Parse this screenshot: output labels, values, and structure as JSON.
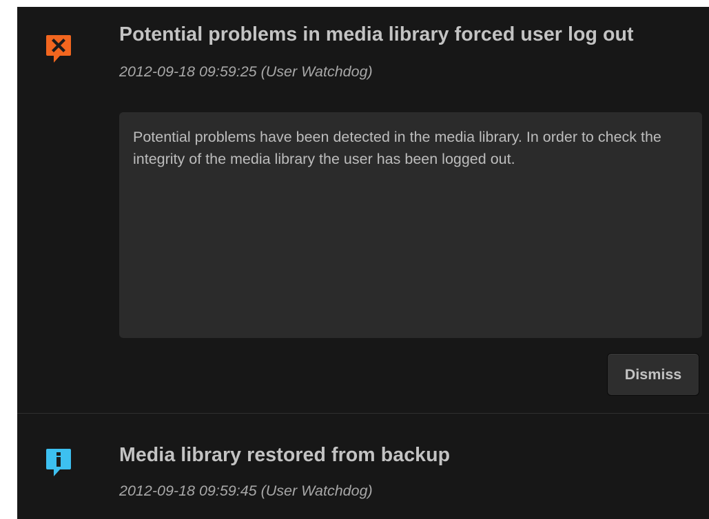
{
  "colors": {
    "panel_background": "#171717",
    "message_background": "#2b2b2b",
    "error_accent": "#f2661f",
    "info_accent": "#3dc0f0"
  },
  "notifications": [
    {
      "type": "error",
      "icon": "error-speech-bubble-icon",
      "title": "Potential problems in media library forced user log out",
      "meta": "2012-09-18 09:59:25 (User Watchdog)",
      "message": "Potential problems have been detected in the media library. In order to check the integrity of the media library the user has been logged out.",
      "dismiss_label": "Dismiss"
    },
    {
      "type": "info",
      "icon": "info-speech-bubble-icon",
      "title": "Media library restored from backup",
      "meta": "2012-09-18 09:59:45 (User Watchdog)"
    }
  ]
}
